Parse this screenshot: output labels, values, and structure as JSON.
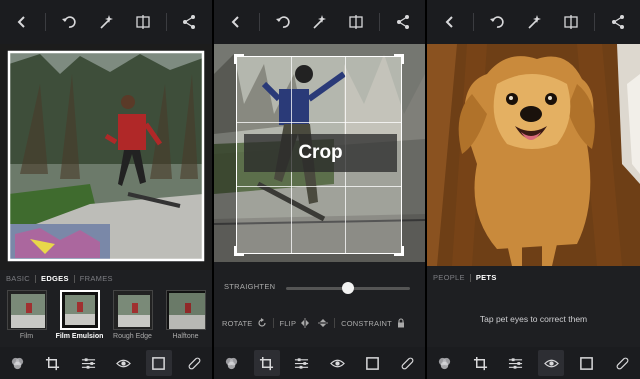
{
  "colors": {
    "panel_bg": "#1e1f22",
    "bar_bg": "#1b1c1f",
    "icon": "#d8d8da",
    "active_text": "#ffffff",
    "muted_text": "#7c7d82"
  },
  "top_toolbar": [
    "back-icon",
    "undo-icon",
    "magic-wand-icon",
    "compare-icon",
    "share-icon"
  ],
  "bottom_toolbar": [
    "filters-icon",
    "crop-icon",
    "adjust-icon",
    "red-eye-icon",
    "borders-icon",
    "bandage-icon"
  ],
  "panel1": {
    "tabs": [
      {
        "label": "BASIC",
        "active": false
      },
      {
        "label": "EDGES",
        "active": true
      },
      {
        "label": "FRAMES",
        "active": false
      }
    ],
    "thumbnails": [
      {
        "label": "Film",
        "selected": false
      },
      {
        "label": "Film Emulsion",
        "selected": true
      },
      {
        "label": "Rough Edge",
        "selected": false
      },
      {
        "label": "Halftone",
        "selected": false
      }
    ],
    "active_tool": "borders-icon"
  },
  "panel2": {
    "crop_label": "Crop",
    "straighten_label": "STRAIGHTEN",
    "straighten_value": 0.5,
    "rotate_label": "ROTATE",
    "flip_label": "FLIP",
    "constraint_label": "CONSTRAINT",
    "active_tool": "crop-icon"
  },
  "panel3": {
    "tabs": [
      {
        "label": "PEOPLE",
        "active": false
      },
      {
        "label": "PETS",
        "active": true
      }
    ],
    "hint": "Tap pet eyes to correct them",
    "active_tool": "red-eye-icon"
  }
}
